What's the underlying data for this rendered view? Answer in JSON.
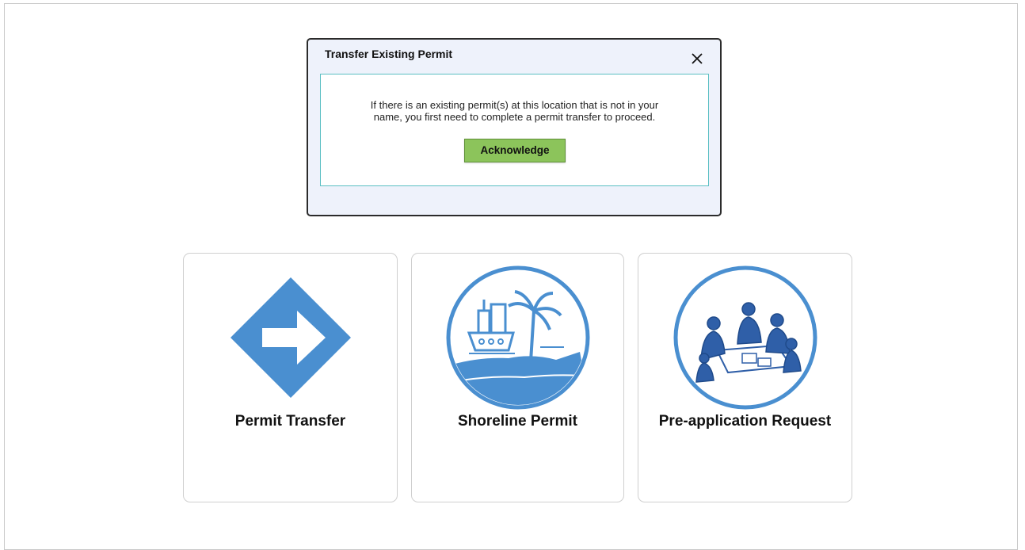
{
  "dialog": {
    "title": "Transfer Existing Permit",
    "message_line1": "If there is an existing permit(s) at this location that is not in your",
    "message_line2": "name, you first need to complete a permit transfer to proceed.",
    "acknowledge_label": "Acknowledge",
    "close_icon": "close-icon"
  },
  "cards": [
    {
      "label": "Permit Transfer",
      "icon": "arrow-diamond-icon"
    },
    {
      "label": "Shoreline Permit",
      "icon": "shoreline-icon"
    },
    {
      "label": "Pre-application Request",
      "icon": "meeting-icon"
    }
  ],
  "colors": {
    "accent_blue": "#4a8fd0",
    "dialog_bg": "#eef2fb",
    "dialog_border": "#2b2b2b",
    "body_border": "#5bbfc3",
    "button_green": "#8cc45b"
  }
}
